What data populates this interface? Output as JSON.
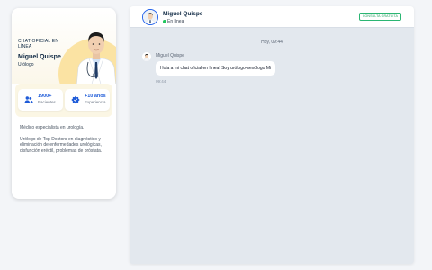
{
  "profile": {
    "tagline": "CHAT OFICIAL EN LÍNEA",
    "name": "Miguel Quispe",
    "role": "Urólogo",
    "stats": [
      {
        "value": "1900+",
        "label": "Pacientes",
        "icon": "patients-icon"
      },
      {
        "value": "+10 años",
        "label": "Experiencia",
        "icon": "experience-icon"
      }
    ],
    "bio": [
      "Médico especialista en urología.",
      "Urólogo de Top Doctors en diagnóstico y eliminación de enfermedades urológicas, disfunción eréctil, problemas de próstata."
    ]
  },
  "chat": {
    "header": {
      "name": "Miguel Quispe",
      "status": "En línea",
      "cta": "Consulta gratuita"
    },
    "day_label": "Hoy, 09:44",
    "messages": [
      {
        "sender": "Miguel Quispe",
        "text": "Hola a mi chat oficial en línea! Soy urólogo-sexólogo Mi",
        "time": "09:44"
      }
    ]
  },
  "colors": {
    "accent": "#2563eb",
    "online": "#22c55e",
    "cta": "#2bb673",
    "chat_bg": "#e3e8ee",
    "hero_blob": "#fbe3a3"
  }
}
